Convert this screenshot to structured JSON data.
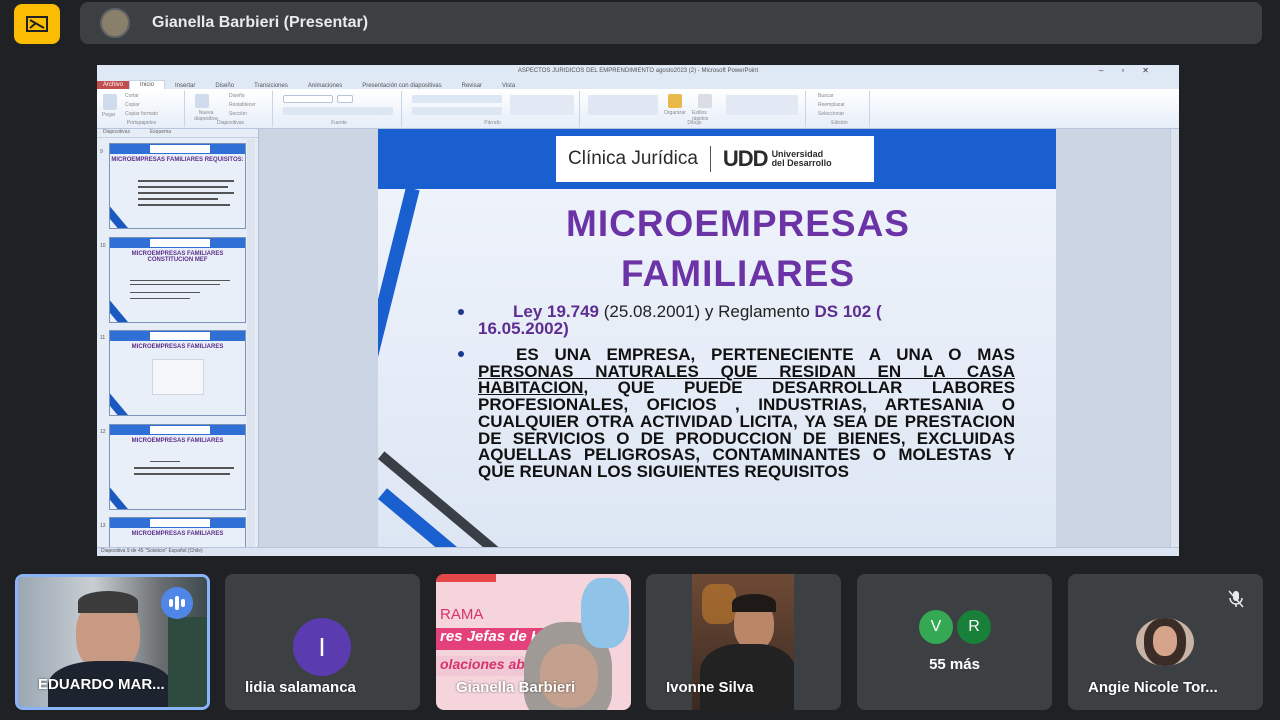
{
  "meeting": {
    "presenter_label": "Gianella Barbieri (Presentar)"
  },
  "window": {
    "title": "ASPECTOS JURIDICOS DEL EMPRENDIMIENTO  agosto2023 (2)  -  Microsoft PowerPoint",
    "tabs": [
      "Archivo",
      "Inicio",
      "Insertar",
      "Diseño",
      "Transiciones",
      "Animaciones",
      "Presentación con diapositivas",
      "Revisar",
      "Vista"
    ],
    "ribbon_groups": [
      "Portapapeles",
      "Diapositivas",
      "Fuente",
      "Párrafo",
      "Dibujo",
      "Edición"
    ],
    "ribbon_labels": {
      "pegar": "Pegar",
      "cortar": "Cortar",
      "copiar": "Copiar",
      "copiar_formato": "Copiar formato",
      "nueva_diapositiva": "Nueva diapositiva",
      "diseno": "Diseño",
      "restablecer": "Restablecer",
      "seccion": "Sección",
      "buscar": "Buscar",
      "reemplazar": "Reemplazar",
      "seleccionar": "Seleccionar",
      "organizar": "Organizar",
      "estilos_rapidos": "Estilos rápidos"
    },
    "panel_tabs": [
      "Diapositivas",
      "Esquema"
    ],
    "status_text": "Diapositiva 9 de 45   \"Solsticio\"   Español (Chile)"
  },
  "thumbnails": [
    {
      "num": "9",
      "title": "MICROEMPRESAS FAMILIARES REQUISITOS:"
    },
    {
      "num": "10",
      "title": "MICROEMPRESAS FAMILIARES CONSTITUCION MEF"
    },
    {
      "num": "11",
      "title": "MICROEMPRESAS FAMILIARES"
    },
    {
      "num": "12",
      "title": "MICROEMPRESAS FAMILIARES"
    },
    {
      "num": "13",
      "title": "MICROEMPRESAS FAMILIARES"
    }
  ],
  "slide": {
    "logo_text": "Clínica Jurídica",
    "logo_udd": "UDD",
    "logo_univ_line1": "Universidad",
    "logo_univ_line2": "del Desarrollo",
    "title_line1": "MICROEMPRESAS",
    "title_line2": "FAMILIARES",
    "bullet1_law": "Ley 19.749",
    "bullet1_date": "(25.08.2001) y Reglamento",
    "bullet1_ds": "DS 102 (",
    "bullet1_ds_date": "16.05.2002)",
    "bullet2_part1": "ES UNA EMPRESA, PERTENECIENTE A UNA O MAS ",
    "bullet2_underlined": "PERSONAS NATURALES QUE RESIDAN EN LA CASA HABITACION",
    "bullet2_part2": ", QUE PUEDE DESARROLLAR LABORES PROFESIONALES, OFICIOS , INDUSTRIAS, ARTESANIA O CUALQUIER OTRA ACTIVIDAD LICITA, YA SEA DE PRESTACION DE SERVICIOS O DE PRODUCCION DE BIENES, EXCLUIDAS AQUELLAS PELIGROSAS, CONTAMINANTES O MOLESTAS Y QUE REUNAN LOS SIGUIENTES REQUISITOS"
  },
  "participants": [
    {
      "name": "EDUARDO MAR...",
      "type": "video",
      "speaking": true
    },
    {
      "name": "lidia salamanca",
      "type": "avatar",
      "initial": "I",
      "color": "#5b3bb0"
    },
    {
      "name": "Gianella Barbieri",
      "type": "video",
      "overlay_line1": "RAMA",
      "overlay_line2": "res Jefas de Ho",
      "overlay_line3": "olaciones abiert"
    },
    {
      "name": "Ivonne Silva",
      "type": "video"
    },
    {
      "name": "55 más",
      "type": "more",
      "avatars": [
        {
          "initial": "V",
          "color": "#34a853"
        },
        {
          "initial": "R",
          "color": "#188038"
        }
      ]
    },
    {
      "name": "Angie Nicole Tor...",
      "type": "photo",
      "muted": true
    }
  ]
}
